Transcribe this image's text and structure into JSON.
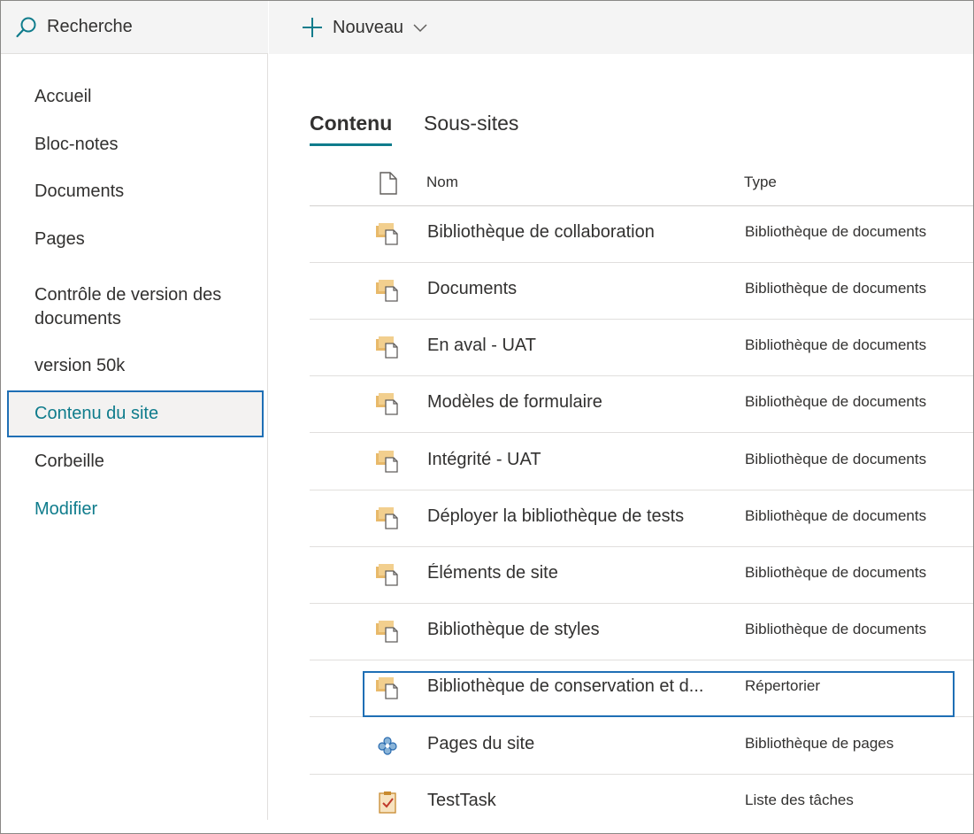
{
  "search": {
    "label": "Recherche",
    "icon": "search-icon"
  },
  "command_bar": {
    "new_label": "Nouveau",
    "icons": [
      "plus-icon",
      "chevron-down-icon"
    ]
  },
  "nav": {
    "items": [
      {
        "label": "Accueil"
      },
      {
        "label": "Bloc-notes"
      },
      {
        "label": "Documents"
      },
      {
        "label": "Pages"
      },
      {
        "label": "Contrôle de version des documents"
      },
      {
        "label": "version 50k"
      },
      {
        "label": "Contenu du site",
        "selected": true
      },
      {
        "label": "Corbeille"
      },
      {
        "label": "Modifier"
      }
    ]
  },
  "tabs": [
    {
      "label": "Contenu",
      "active": true
    },
    {
      "label": "Sous-sites"
    }
  ],
  "table": {
    "columns": {
      "icon": "document-icon",
      "name": "Nom",
      "type": "Type"
    },
    "rows": [
      {
        "name": "Bibliothèque de collaboration",
        "type": "Bibliothèque de documents",
        "icon": "document-library-icon"
      },
      {
        "name": "Documents",
        "type": "Bibliothèque de documents",
        "icon": "document-library-icon"
      },
      {
        "name": "En aval - UAT",
        "type": "Bibliothèque de documents",
        "icon": "document-library-icon"
      },
      {
        "name": "Modèles de formulaire",
        "type": "Bibliothèque de documents",
        "icon": "document-library-icon"
      },
      {
        "name": "Intégrité - UAT",
        "type": "Bibliothèque de documents",
        "icon": "document-library-icon"
      },
      {
        "name": "Déployer la bibliothèque de tests",
        "type": "Bibliothèque de documents",
        "icon": "document-library-icon"
      },
      {
        "name": "Éléments de site",
        "type": "Bibliothèque de documents",
        "icon": "document-library-icon"
      },
      {
        "name": "Bibliothèque de styles",
        "type": "Bibliothèque de documents",
        "icon": "document-library-icon"
      },
      {
        "name": "Bibliothèque de conservation et d...",
        "type": "Répertorier",
        "icon": "document-library-icon",
        "highlighted": true
      },
      {
        "name": "Pages du site",
        "type": "Bibliothèque de pages",
        "icon": "site-pages-icon"
      },
      {
        "name": "TestTask",
        "type": "Liste des tâches",
        "icon": "task-list-icon"
      }
    ]
  },
  "colors": {
    "accent": "#0f7c8c",
    "highlight_border": "#1f6fb5",
    "library_icon": "#e8b96a"
  }
}
